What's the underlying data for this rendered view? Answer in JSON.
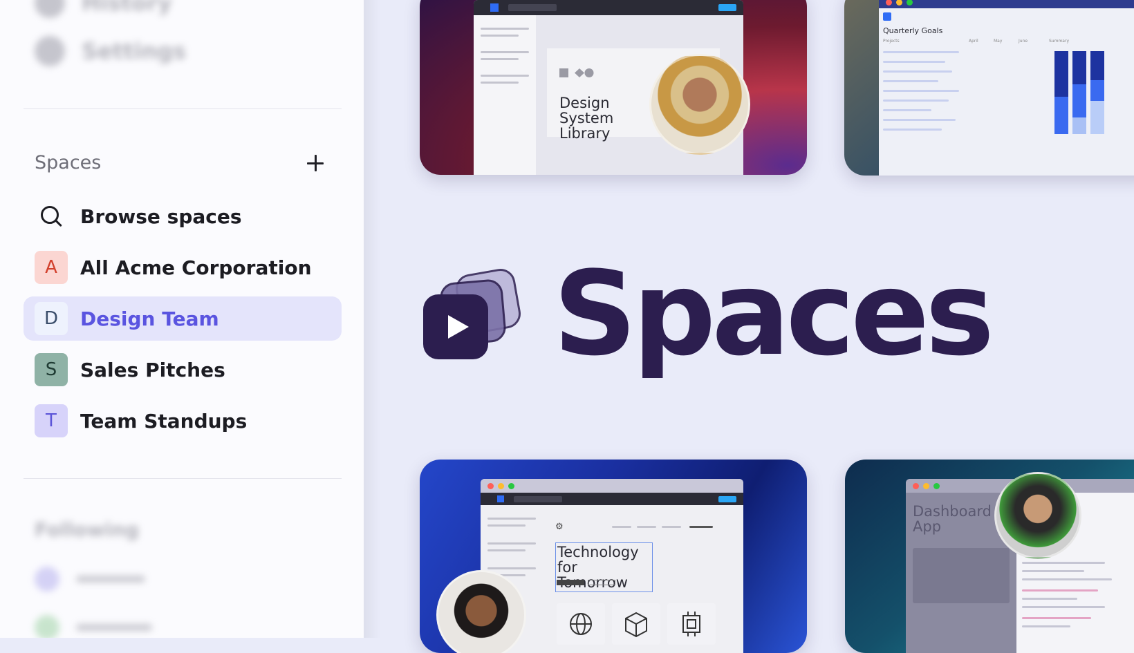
{
  "sidebar": {
    "blurred_top": [
      "History",
      "Settings"
    ],
    "spaces_heading": "Spaces",
    "items": [
      {
        "label": "Browse spaces",
        "icon": "search-icon"
      },
      {
        "label": "All Acme Corporation",
        "initial": "A",
        "bg": "#fbd6d2",
        "fg": "#d2402c"
      },
      {
        "label": "Design Team",
        "initial": "D",
        "bg": "#e8eefc",
        "fg": "#3a4d6a",
        "active": true
      },
      {
        "label": "Sales Pitches",
        "initial": "S",
        "bg": "#8fb2a6",
        "fg": "#1f3b33"
      },
      {
        "label": "Team Standups",
        "initial": "T",
        "bg": "#d7d3fa",
        "fg": "#5c55d8"
      }
    ],
    "following_heading": "Following"
  },
  "main": {
    "brand_name": "Spaces",
    "cards": [
      {
        "title": "Design System Library"
      },
      {
        "title": "Quarterly Goals",
        "columns": [
          "Projects",
          "April",
          "May",
          "June",
          "Summary"
        ]
      },
      {
        "title": "Technology for Tomorrow"
      },
      {
        "title": "Dashboard App"
      }
    ]
  },
  "colors": {
    "accent": "#5a54e0",
    "brand": "#2c1e4f",
    "active_bg": "#e4e4fb"
  }
}
